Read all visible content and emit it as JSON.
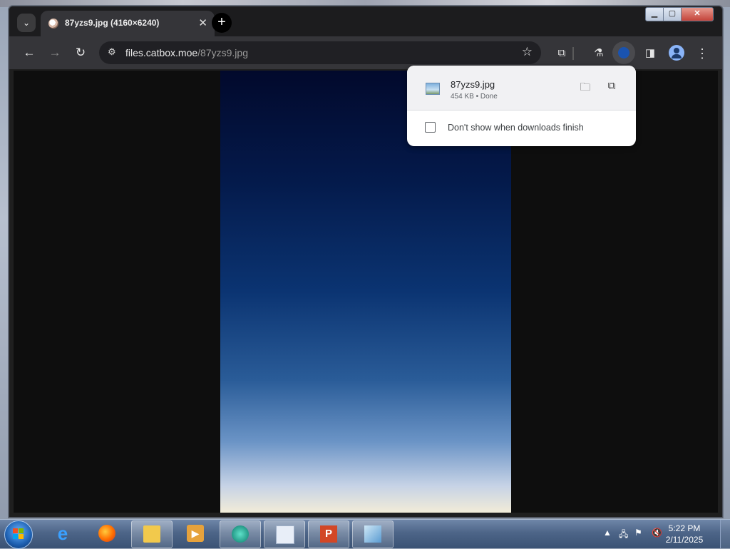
{
  "browser": {
    "tab": {
      "title": "87yzs9.jpg (4160×6240)"
    },
    "address_bar": {
      "host": "files.catbox.moe",
      "path": "/87yzs9.jpg"
    }
  },
  "download_bubble": {
    "file_name": "87yzs9.jpg",
    "file_size": "454 KB",
    "separator": " • ",
    "status": "Done",
    "checkbox_label": "Don't show when downloads finish",
    "checkbox_checked": false
  },
  "taskbar": {
    "apps": [
      "internet-explorer-icon",
      "firefox-icon",
      "file-explorer-icon",
      "media-player-icon",
      "active-app-icon",
      "document-icon",
      "powerpoint-icon",
      "app-icon"
    ],
    "clock": {
      "time": "5:22 PM",
      "date": "2/11/2025"
    }
  }
}
